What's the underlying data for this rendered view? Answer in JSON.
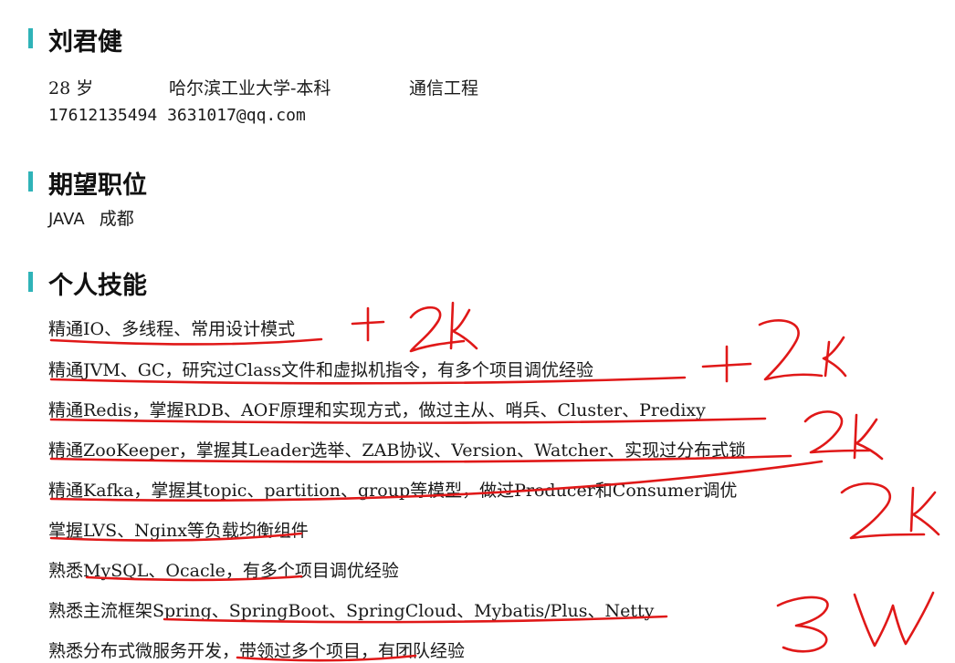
{
  "profile": {
    "name": "刘君健",
    "age": "28 岁",
    "school": "哈尔滨工业大学-本科",
    "major": "通信工程",
    "phone": "17612135494",
    "email": "3631017@qq.com"
  },
  "expected": {
    "heading": "期望职位",
    "position": "JAVA",
    "city": "成都"
  },
  "skills": {
    "heading": "个人技能",
    "items": [
      "精通IO、多线程、常用设计模式",
      "精通JVM、GC，研究过Class文件和虚拟机指令，有多个项目调优经验",
      "精通Redis，掌握RDB、AOF原理和实现方式，做过主从、哨兵、Cluster、Predixy",
      "精通ZooKeeper，掌握其Leader选举、ZAB协议、Version、Watcher、实现过分布式锁",
      "精通Kafka，掌握其topic、partition、group等模型，做过Producer和Consumer调优",
      "掌握LVS、Nginx等负载均衡组件",
      "熟悉MySQL、Ocacle，有多个项目调优经验",
      "熟悉主流框架Spring、SpringBoot、SpringCloud、Mybatis/Plus、Netty",
      "熟悉分布式微服务开发，带领过多个项目，有团队经验"
    ]
  },
  "annotations": {
    "color": "#e01818",
    "notes": [
      "+2K",
      "+2K",
      "2K",
      "2K",
      "3W"
    ]
  }
}
